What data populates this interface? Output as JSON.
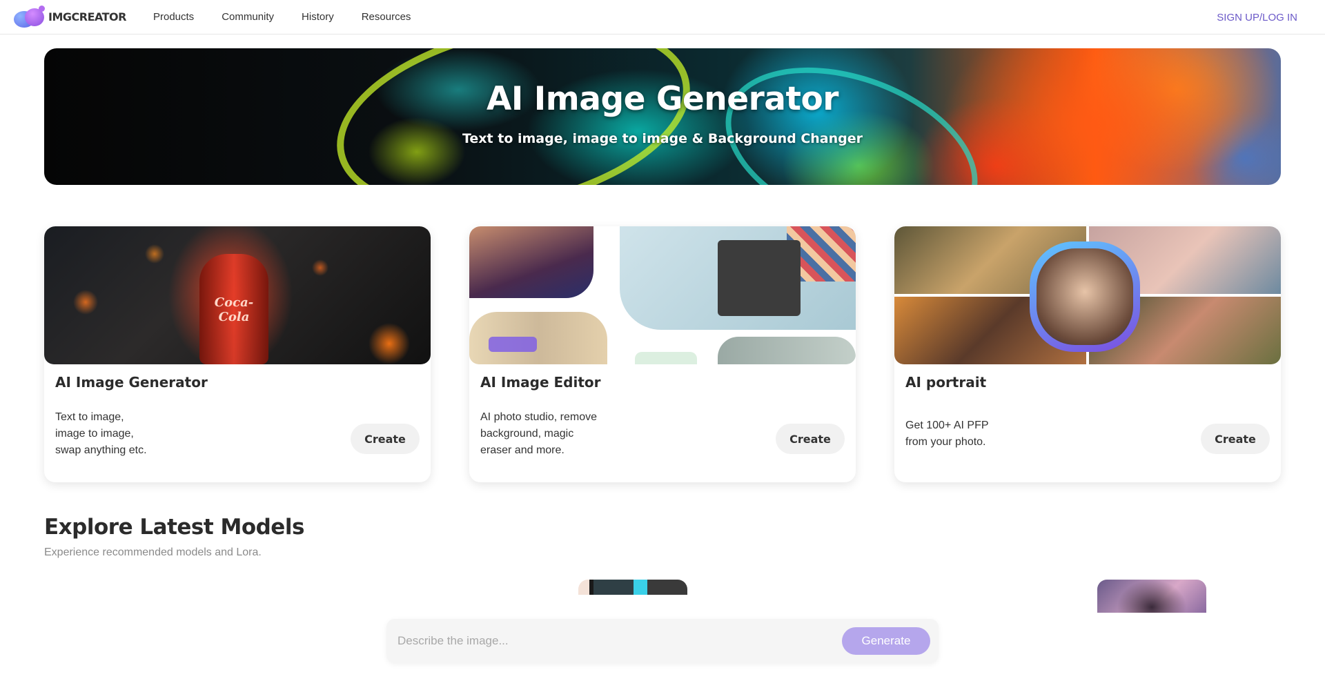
{
  "nav": {
    "brand": "IMGCREATOR",
    "links": [
      "Products",
      "Community",
      "History",
      "Resources"
    ],
    "signup": "SIGN UP/LOG IN"
  },
  "hero": {
    "title": "AI Image Generator",
    "subtitle": "Text to image, image to image & Background Changer"
  },
  "cards": [
    {
      "title": "AI Image Generator",
      "desc_lines": [
        "Text to image,",
        "image to image,",
        "swap anything etc."
      ],
      "button": "Create",
      "image_text": "Coca-Cola"
    },
    {
      "title": "AI Image Editor",
      "desc_lines": [
        "AI photo studio, remove",
        "background, magic",
        "eraser and more."
      ],
      "button": "Create"
    },
    {
      "title": "AI portrait",
      "desc_lines": [
        "Get 100+ AI PFP",
        "from your photo."
      ],
      "button": "Create"
    }
  ],
  "explore": {
    "title": "Explore Latest Models",
    "subtitle": "Experience recommended models and Lora."
  },
  "prompt": {
    "placeholder": "Describe the image...",
    "generate_label": "Generate"
  },
  "colors": {
    "accent": "#6b59c8",
    "generate_button": "#b5a6ec"
  }
}
